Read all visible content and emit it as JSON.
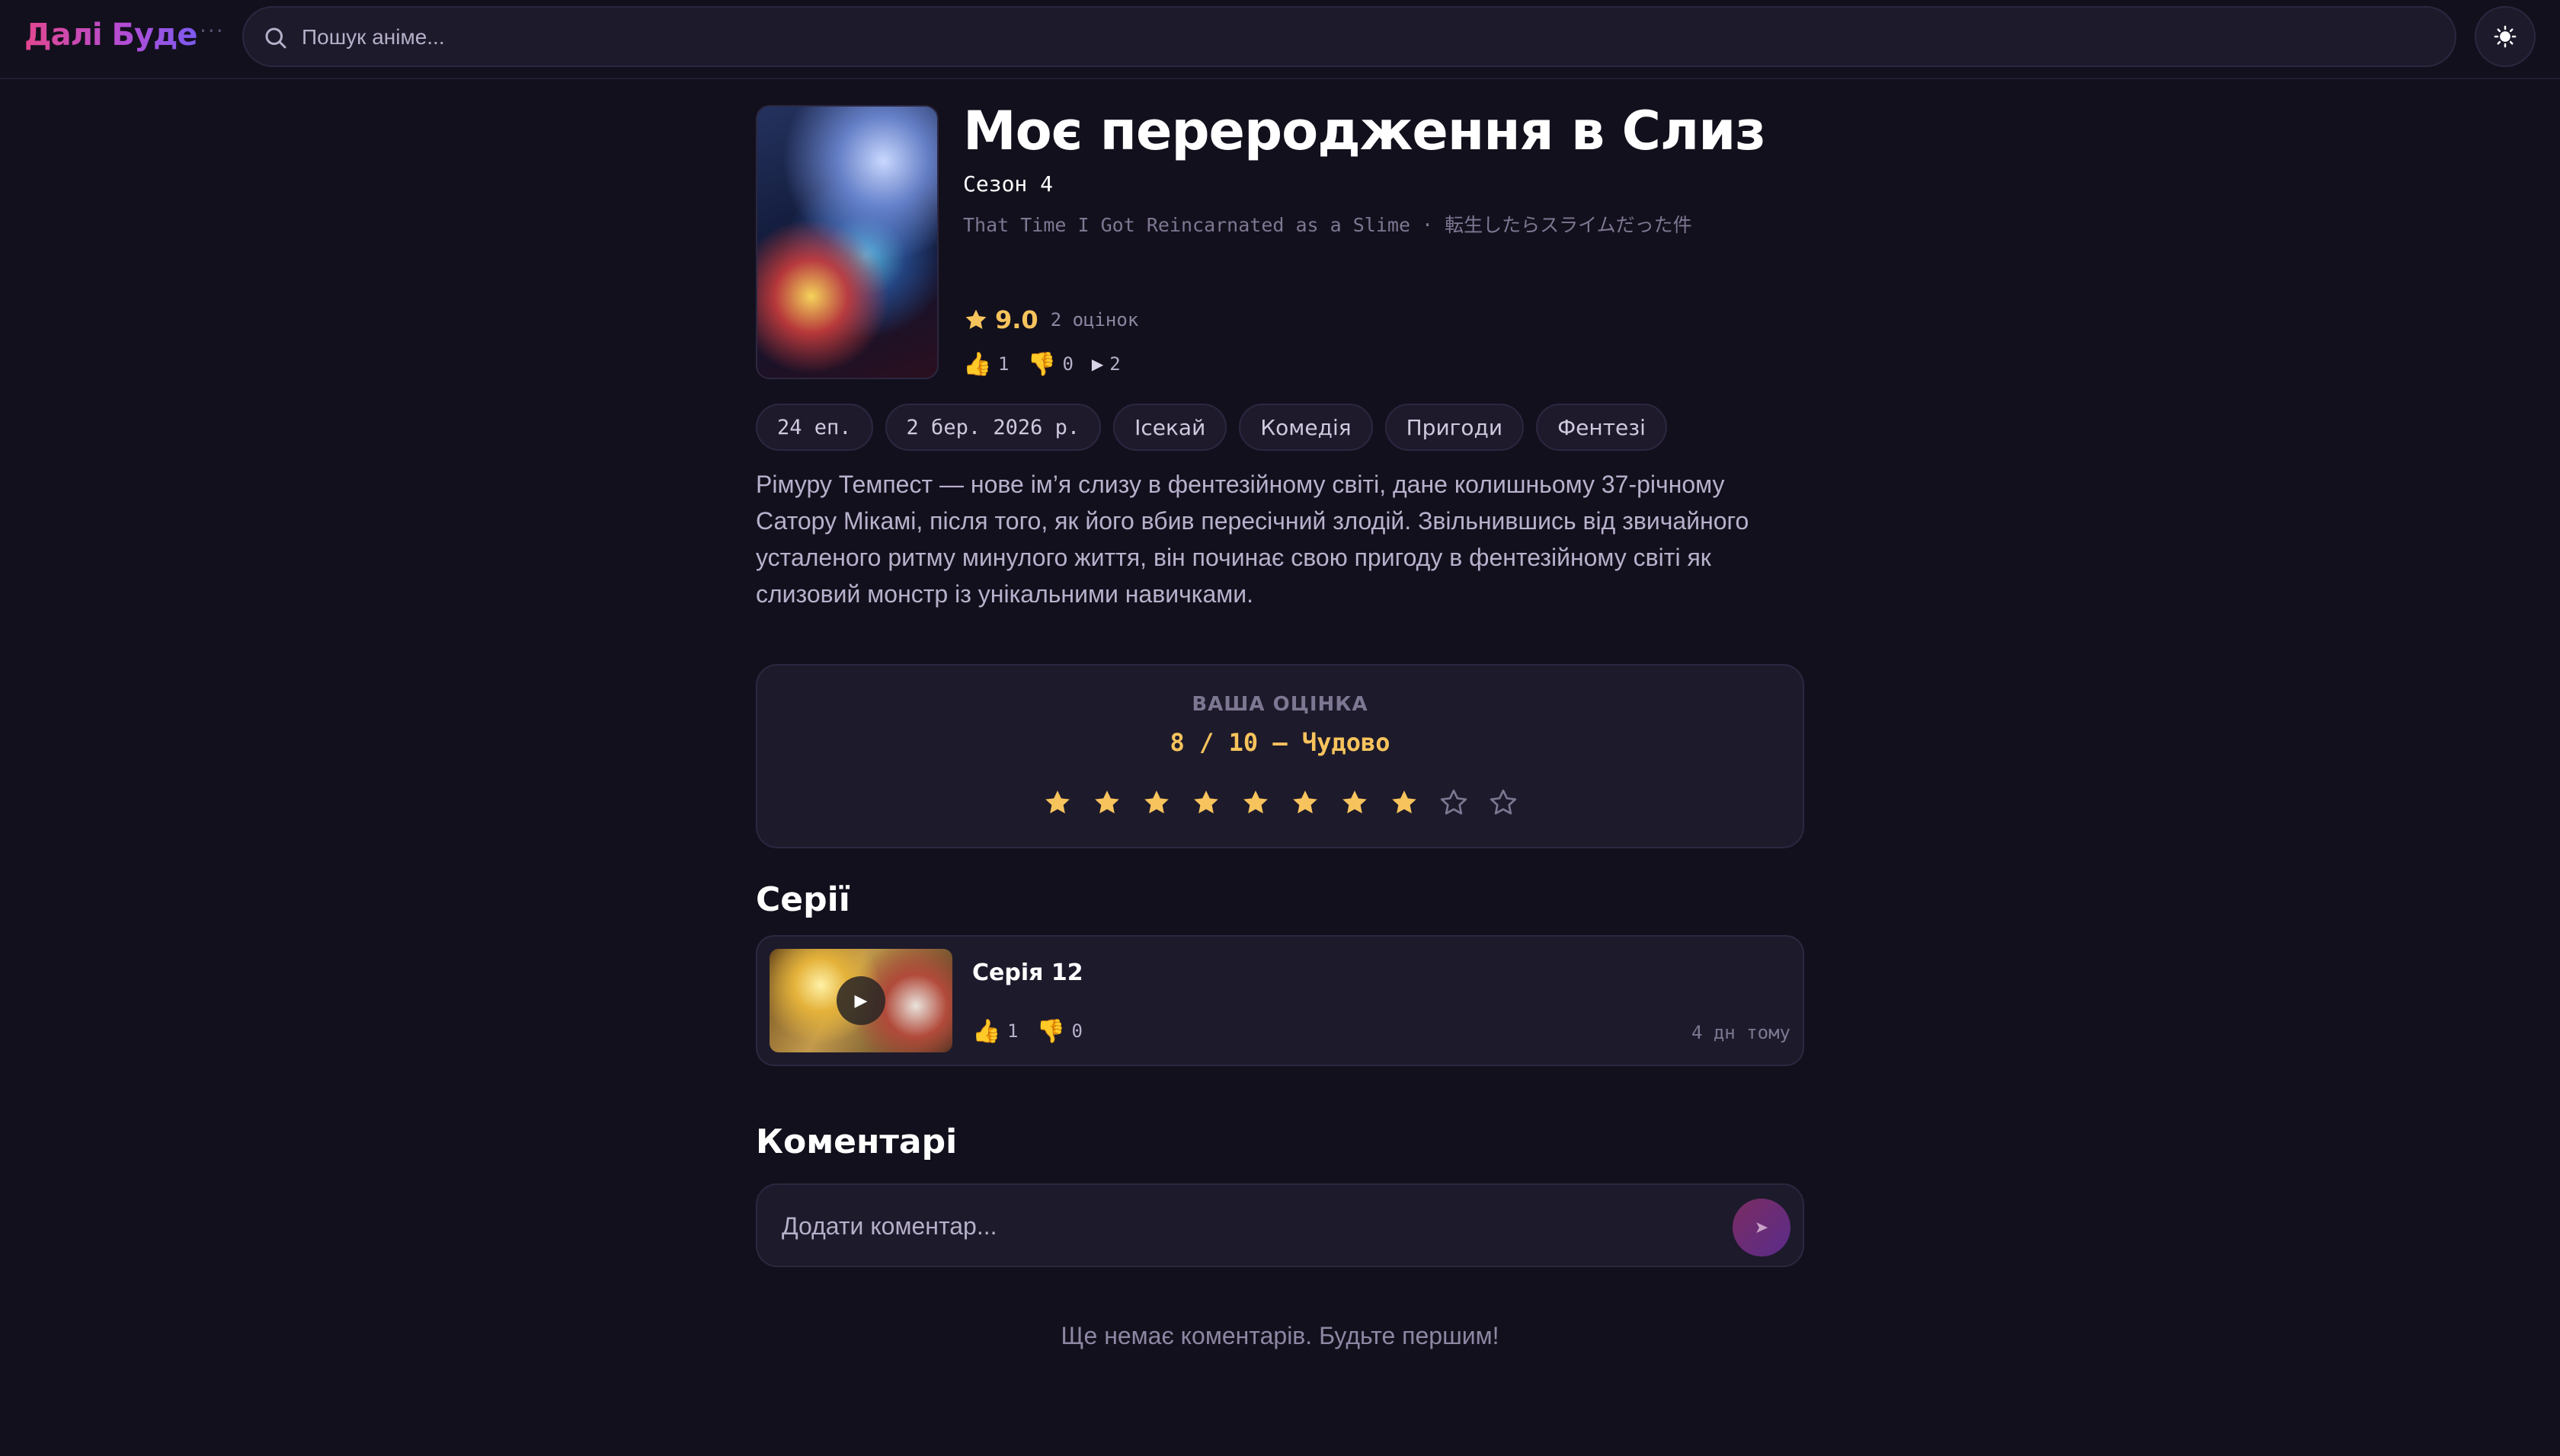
{
  "header": {
    "logo": "Далі Буде",
    "logo_suffix": "···",
    "search_placeholder": "Пошук аніме...",
    "theme_icon": "sun-icon"
  },
  "anime": {
    "title": "Моє переродження в Слиз",
    "season": "Сезон 4",
    "alt_titles": "That Time I Got Reincarnated as a Slime · 転生したらスライムだった件",
    "rating": "9.0",
    "rating_count": "2 оцінок",
    "likes": "1",
    "dislikes": "0",
    "views": "2",
    "tags": [
      "24 еп.",
      "2 бер. 2026 р.",
      "Ісекай",
      "Комедія",
      "Пригоди",
      "Фентезі"
    ],
    "description": "Рімуру Темпест — нове ім’я слизу в фентезійному світі, дане колишньому 37-річному Сатору Мікамі, після того, як його вбив пересічний злодій. Звільнившись від звичайного усталеного ритму минулого життя, він починає свою пригоду в фентезійному світі як слизовий монстр із унікальними навичками."
  },
  "your_rating": {
    "label": "ВАША ОЦІНКА",
    "value": "8 / 10 — Чудово",
    "score": 8,
    "max": 10
  },
  "episodes": {
    "section_title": "Серії",
    "items": [
      {
        "title": "Серія 12",
        "likes": "1",
        "dislikes": "0",
        "time_ago": "4 дн тому"
      }
    ]
  },
  "comments": {
    "section_title": "Коментарі",
    "placeholder": "Додати коментар...",
    "empty_text": "Ще немає коментарів. Будьте першим!"
  },
  "colors": {
    "background": "#13101d",
    "card": "#1d1a2b",
    "accent_gold": "#f7c35c",
    "brand_pink": "#e2478f",
    "brand_violet": "#7b5bf0"
  }
}
